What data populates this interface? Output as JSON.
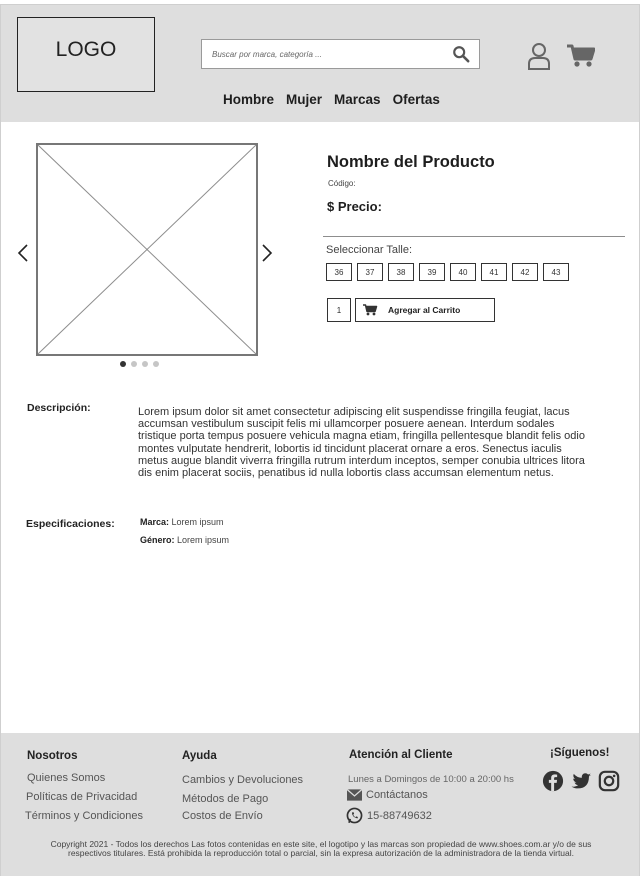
{
  "header": {
    "logo": "LOGO",
    "search_placeholder": "Buscar por marca, categoría ...",
    "nav": [
      "Hombre",
      "Mujer",
      "Marcas",
      "Ofertas"
    ]
  },
  "product": {
    "name": "Nombre del Producto",
    "code_label": "Código:",
    "price_label": "$ Precio:",
    "size_label": "Seleccionar Talle:",
    "sizes": [
      "36",
      "37",
      "38",
      "39",
      "40",
      "41",
      "42",
      "43"
    ],
    "quantity": "1",
    "add_to_cart": "Agregar al Carrito",
    "gallery_slides": 4,
    "active_slide": 1
  },
  "description": {
    "label": "Descripción:",
    "text": "Lorem ipsum dolor sit amet consectetur adipiscing elit suspendisse fringilla feugiat, lacus accumsan vestibulum suscipit felis mi ullamcorper posuere aenean. Interdum sodales tristique porta tempus posuere vehicula magna etiam, fringilla pellentesque blandit felis odio montes vulputate hendrerit, lobortis id tincidunt placerat ornare a eros. Senectus iaculis metus augue blandit viverra fringilla rutrum interdum inceptos, semper conubia ultrices litora dis enim placerat sociis, penatibus id nulla lobortis class accumsan elementum netus."
  },
  "specs": {
    "label": "Especificaciones:",
    "marca_label": "Marca:",
    "marca_value": "Lorem ipsum",
    "genero_label": "Género:",
    "genero_value": "Lorem ipsum"
  },
  "footer": {
    "nosotros": {
      "title": "Nosotros",
      "links": [
        "Quienes Somos",
        "Políticas de Privacidad",
        "Términos y Condiciones"
      ]
    },
    "ayuda": {
      "title": "Ayuda",
      "links": [
        "Cambios y Devoluciones",
        "Métodos de Pago",
        "Costos de Envío"
      ]
    },
    "atencion": {
      "title": "Atención al Cliente",
      "hours": "Lunes a Domingos de 10:00 a 20:00 hs",
      "contact": "Contáctanos",
      "phone": "15-88749632"
    },
    "social": {
      "title": "¡Síguenos!",
      "icons": [
        "facebook-icon",
        "twitter-icon",
        "instagram-icon"
      ]
    },
    "copyright": "Copyright 2021 - Todos los derechos Las fotos contenidas en este site, el logotipo y las marcas son propiedad de www.shoes.com.ar y/o de sus respectivos titulares. Está prohibida la reproducción total o parcial, sin la expresa autorización de la administradora de la tienda virtual."
  },
  "colors": {
    "header_bg": "#dedede",
    "footer_bg": "#dedede",
    "icon_gray": "#666666"
  }
}
